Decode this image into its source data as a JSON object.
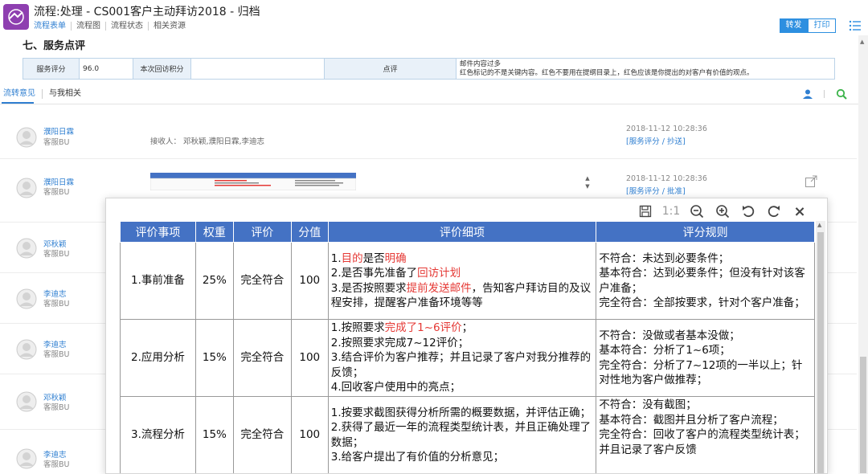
{
  "header": {
    "title": "流程:处理 - CS001客户主动拜访2018 - 归档",
    "nav": [
      "流程表单",
      "流程图",
      "流程状态",
      "相关资源"
    ],
    "btn_forward": "转发",
    "btn_print": "打印"
  },
  "section": {
    "title": "七、服务点评",
    "score_label": "服务评分",
    "score_value": "96.0",
    "visit_label": "本次回访积分",
    "visit_value": "",
    "comment_label": "点评",
    "comment_line1": "邮件内容过多",
    "comment_line2": "红色标记的不是关键内容。红色不要用在提纲目录上，红色应该是你提出的对客户有价值的观点。"
  },
  "tabs": [
    "流转意见",
    "与我相关"
  ],
  "rows": [
    {
      "name": "濮阳日霖",
      "dept": "客服BU",
      "receivers": "接收人：  邓秋颖,濮阳日霖,李迪志",
      "time": "2018-11-12   10:28:36",
      "action": "[服务评分 / 抄送]"
    },
    {
      "name": "濮阳日霖",
      "dept": "客服BU",
      "receivers": "",
      "time": "2018-11-12   10:28:36",
      "action": "[服务评分 / 批准]"
    },
    {
      "name": "邓秋颖",
      "dept": "客服BU"
    },
    {
      "name": "李迪志",
      "dept": "客服BU"
    },
    {
      "name": "李迪志",
      "dept": "客服BU"
    },
    {
      "name": "邓秋颖",
      "dept": "客服BU"
    },
    {
      "name": "李迪志",
      "dept": "客服BU"
    }
  ],
  "viewer": {
    "ratio_label": "1:1",
    "close_label": "×",
    "headers": [
      "评价事项",
      "权重",
      "评价",
      "分值",
      "评价细项",
      "评分规则"
    ],
    "items": [
      {
        "item": "1.事前准备",
        "weight": "25%",
        "eval": "完全符合",
        "score": "100",
        "d1a": "1.",
        "d1b": "目的",
        "d1c": "是否",
        "d1d": "明确",
        "d2a": "2.是否事先准备了",
        "d2b": "回访计划",
        "d3a": "3.是否按照要求",
        "d3b": "提前发送邮件",
        "d3c": "，告知客户拜访目的及议程安排，提醒客户准备环境等等",
        "rules": "不符合：未达到必要条件；\n基本符合：达到必要条件；但没有针对该客户准备；\n完全符合：全部按要求，针对个客户准备；"
      },
      {
        "item": "2.应用分析",
        "weight": "15%",
        "eval": "完全符合",
        "score": "100",
        "d1a": "1.按照要求",
        "d1b": "完成了1~6评价",
        "d2": "2.按照要求完成7~12评价；",
        "d3": "3.结合评价为客户推荐；并且记录了客户对我分推荐的反馈；",
        "d4": "4.回收客户使用中的亮点；",
        "rules": "不符合：没做或者基本没做；\n基本符合：分析了1~6项；\n完全符合：分析了7~12项的一半以上；针对性地为客户做推荐；"
      },
      {
        "item": "3.流程分析",
        "weight": "15%",
        "eval": "完全符合",
        "score": "100",
        "d1": "1.按要求截图获得分析所需的概要数据，并评估正确；",
        "d2": "2.获得了最近一年的流程类型统计表，并且正确处理了数据；",
        "d3": "3.给客户提出了有价值的分析意见；",
        "rules": "不符合：没有截图；\n基本符合：截图并且分析了客户流程；\n完全符合：回收了客户的流程类型统计表；并且记录了客户反馈"
      }
    ]
  }
}
